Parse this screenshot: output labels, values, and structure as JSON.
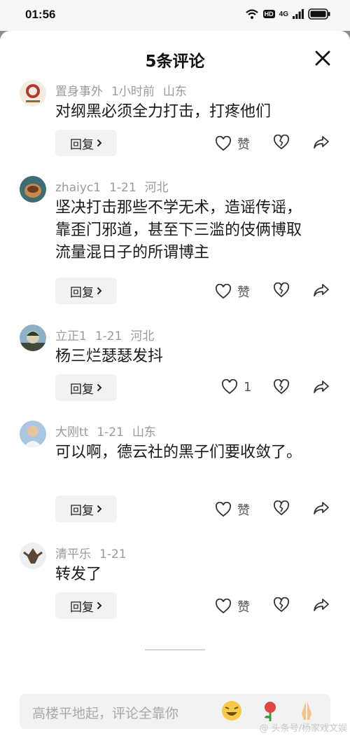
{
  "status_bar": {
    "time": "01:56",
    "hd": "HD",
    "network": "4G"
  },
  "sheet": {
    "title": "5条评论"
  },
  "comments": [
    {
      "name": "置身事外",
      "time": "1小时前",
      "location": "山东",
      "text": "对纲黑必须全力打击，打疼他们",
      "reply_label": "回复",
      "like_label": "赞"
    },
    {
      "name": "zhaiyc1",
      "time": "1-21",
      "location": "河北",
      "text": "坚决打击那些不学无术，造谣传谣，靠歪门邪道，甚至下三滥的伎俩博取流量混日子的所谓博主",
      "reply_label": "回复",
      "like_label": "赞"
    },
    {
      "name": "立正1",
      "time": "1-21",
      "location": "河北",
      "text": "杨三烂瑟瑟发抖",
      "reply_label": "回复",
      "like_label": "1"
    },
    {
      "name": "大刚tt",
      "time": "1-21",
      "location": "山东",
      "text": "可以啊，德云社的黑子们要收敛了。",
      "reply_label": "回复",
      "like_label": "赞"
    },
    {
      "name": "清平乐",
      "time": "1-21",
      "location": "",
      "text": "转发了",
      "reply_label": "回复",
      "like_label": "赞"
    }
  ],
  "input": {
    "placeholder": "高楼平地起，评论全靠你"
  },
  "watermark": "@ 头条号/杨家戏文娱"
}
